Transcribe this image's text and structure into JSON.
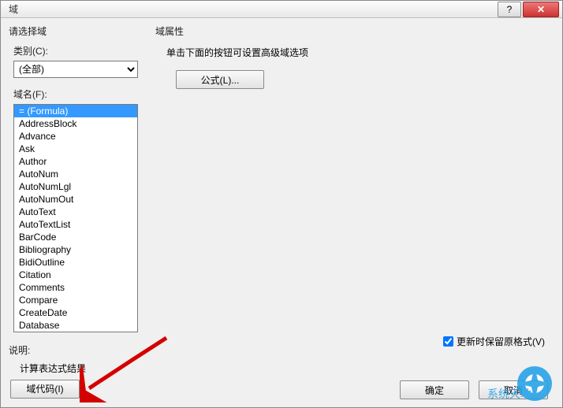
{
  "title": "域",
  "titlebar": {
    "help": "?",
    "close": "✕"
  },
  "left": {
    "header": "请选择域",
    "category_label": "类别(C):",
    "category_value": "(全部)",
    "fieldname_label": "域名(F):",
    "items": [
      "= (Formula)",
      "AddressBlock",
      "Advance",
      "Ask",
      "Author",
      "AutoNum",
      "AutoNumLgl",
      "AutoNumOut",
      "AutoText",
      "AutoTextList",
      "BarCode",
      "Bibliography",
      "BidiOutline",
      "Citation",
      "Comments",
      "Compare",
      "CreateDate",
      "Database"
    ],
    "selected_index": 0
  },
  "desc": {
    "label": "说明:",
    "text": "计算表达式结果"
  },
  "right": {
    "header": "域属性",
    "instruction": "单击下面的按钮可设置高级域选项",
    "formula_btn": "公式(L)...",
    "preserve_label": "更新时保留原格式(V)",
    "preserve_checked": true
  },
  "footer": {
    "fieldcodes_btn": "域代码(I)",
    "ok_btn": "确定",
    "cancel_btn": "取消"
  },
  "watermark": "系统天地"
}
